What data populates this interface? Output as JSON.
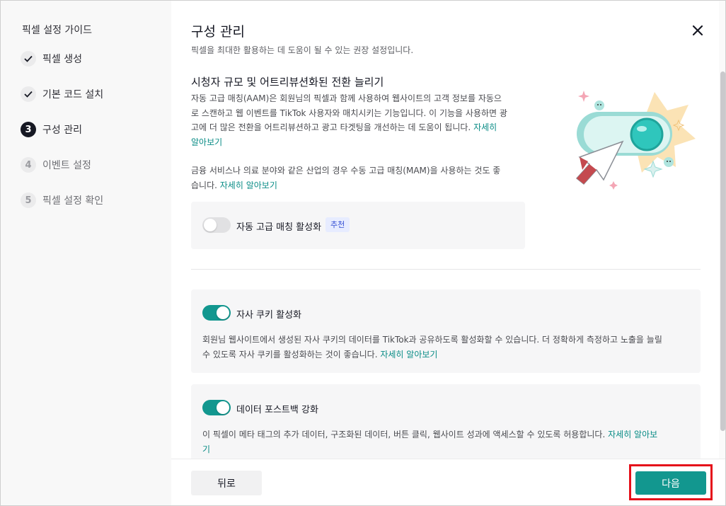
{
  "sidebar": {
    "title": "픽셀 설정 가이드",
    "steps": [
      {
        "mark": "",
        "label": "픽셀 생성",
        "state": "done"
      },
      {
        "mark": "",
        "label": "기본 코드 설치",
        "state": "done"
      },
      {
        "mark": "3",
        "label": "구성 관리",
        "state": "active"
      },
      {
        "mark": "4",
        "label": "이벤트 설정",
        "state": "todo"
      },
      {
        "mark": "5",
        "label": "픽셀 설정 확인",
        "state": "todo"
      }
    ]
  },
  "header": {
    "title": "구성 관리",
    "subtitle": "픽셀을 최대한 활용하는 데 도움이 될 수 있는 권장 설정입니다.",
    "close_icon": "close-icon"
  },
  "aam_section": {
    "heading": "시청자 규모 및 어트리뷰션화된 전환 늘리기",
    "para1_lines": [
      "자동 고급 매칭(AAM)은 회원님의 픽셀과 함께 사용하여 웹사이트의 고객 정보를 자동으",
      "로 스캔하고 웹 이벤트를 TikTok 사용자와 매치시키는 기능입니다. 이 기능을 사용하면 광",
      "고에 더 많은 전환을 어트리뷰션하고 광고 타겟팅을 개선하는 데 도움이 됩니다."
    ],
    "para1_link_a": "자세히",
    "para1_link_b": "알아보기",
    "para2_lines": [
      "금융 서비스나 의료 분야와 같은 산업의 경우 수동 고급 매칭(MAM)을 사용하는 것도 좋",
      "습니다."
    ],
    "para2_link": "자세히 알아보기",
    "toggle_label": "자동 고급 매칭 활성화",
    "toggle_on": false,
    "badge": "추천"
  },
  "cookie_card": {
    "toggle_label": "자사 쿠키 활성화",
    "toggle_on": true,
    "desc_line1": "회원님 웹사이트에서 생성된 자사 쿠키의 데이터를 TikTok과 공유하도록 활성화할 수 있습니다. 더 정확하게 측정하고 노출을 늘릴",
    "desc_line2": "수 있도록 자사 쿠키를 활성화하는 것이 좋습니다.",
    "link": "자세히 알아보기"
  },
  "postback_card": {
    "toggle_label": "데이터 포스트백 강화",
    "toggle_on": true,
    "desc_line1": "이 픽셀이 메타 태그의 추가 데이터, 구조화된 데이터, 버튼 클릭, 웹사이트 성과에 액세스할 수 있도록 허용합니다.",
    "link_a": "자세히 알아보",
    "link_b": "기"
  },
  "footer": {
    "back_label": "뒤로",
    "next_label": "다음"
  },
  "colors": {
    "accent": "#12978f",
    "link": "#0a8c86",
    "highlight": "#e5101a",
    "badge_bg": "#e7ecff",
    "badge_text": "#3650d4"
  }
}
